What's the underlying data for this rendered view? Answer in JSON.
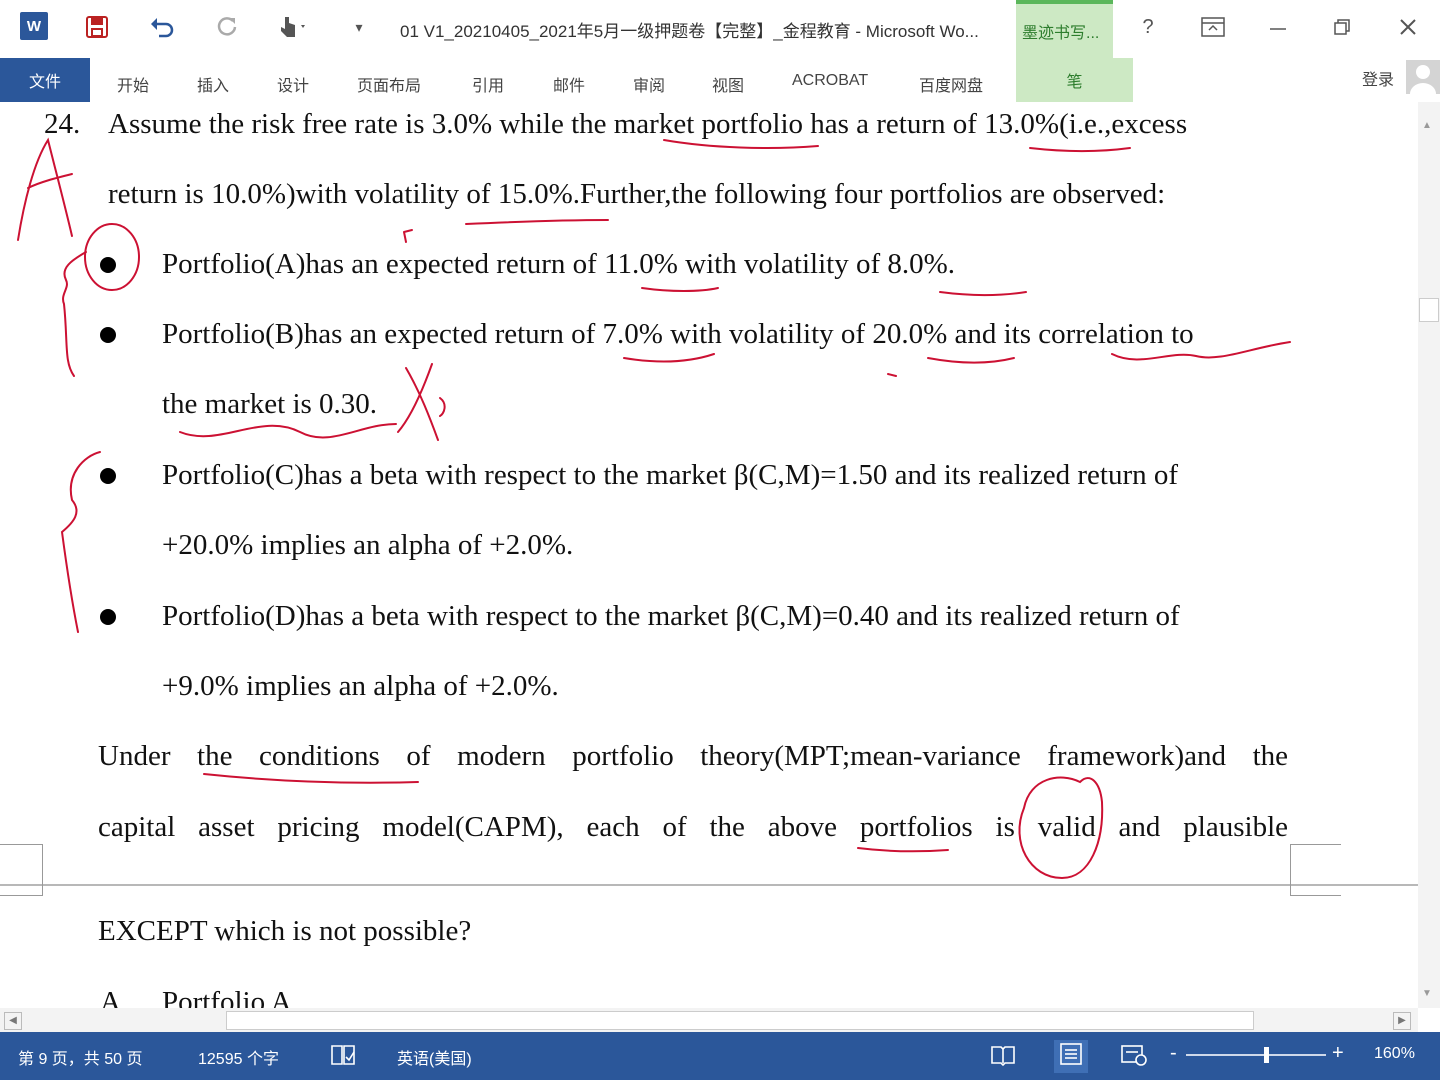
{
  "window": {
    "title": "01 V1_20210405_2021年5月一级押题卷【完整】_金程教育 - Microsoft Wo...",
    "ink_tab": "墨迹书写...",
    "help": "?",
    "login": "登录"
  },
  "ribbon": {
    "tabs": [
      "文件",
      "开始",
      "插入",
      "设计",
      "页面布局",
      "引用",
      "邮件",
      "审阅",
      "视图",
      "ACROBAT",
      "百度网盘",
      "笔"
    ]
  },
  "document": {
    "q_number": "24.",
    "q_line1": "Assume the risk free rate is 3.0% while the market portfolio has a return of 13.0%(i.e.,excess",
    "q_line2": "return is 10.0%)with volatility of 15.0%.Further,the following four portfolios are observed:",
    "a_line1": "Portfolio(A)has an expected return of 11.0% with volatility of 8.0%.",
    "b_line1": "Portfolio(B)has an expected return of 7.0% with volatility of 20.0% and its correlation to",
    "b_line2": "the market is 0.30.",
    "c_line1": "Portfolio(C)has a beta with respect to the market β(C,M)=1.50 and its realized return of",
    "c_line2": "+20.0% implies an alpha of +2.0%.",
    "d_line1": "Portfolio(D)has a beta with respect to the market β(C,M)=0.40 and its realized return of",
    "d_line2": "+9.0% implies an alpha of +2.0%.",
    "u_line1": "Under the conditions of modern portfolio theory(MPT;mean-variance framework)and the",
    "u_line2": "capital asset pricing model(CAPM), each of the above portfolios is valid and plausible",
    "u_line3": "EXCEPT which is not possible?",
    "option_letter": "A",
    "option_text": "Portfolio A",
    "annotation_letter": "A"
  },
  "statusbar": {
    "page": "第 9 页，共 50 页",
    "words": "12595 个字",
    "language": "英语(美国)",
    "zoom": "160%"
  },
  "colors": {
    "brand": "#2b579a",
    "ink": "#cc1133",
    "ink_tab": "#cde9c4"
  }
}
